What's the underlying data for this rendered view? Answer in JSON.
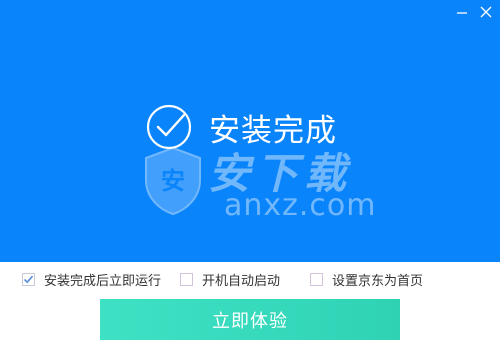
{
  "window": {
    "minimize_icon": "minimize-icon",
    "close_icon": "close-icon"
  },
  "status": {
    "icon": "check-circle-icon",
    "text": "安装完成"
  },
  "watermark": {
    "chinese": "安下载",
    "english": "anxz.com",
    "badge": "安"
  },
  "options": [
    {
      "label": "安装完成后立即运行",
      "checked": true
    },
    {
      "label": "开机自动启动",
      "checked": false
    },
    {
      "label": "设置京东为首页",
      "checked": false
    }
  ],
  "cta": {
    "label": "立即体验"
  },
  "colors": {
    "header_bg": "#0a84fb",
    "button_gradient_start": "#3fe1c4",
    "button_gradient_end": "#2fd3b4",
    "check_color": "#5a8fd6"
  }
}
